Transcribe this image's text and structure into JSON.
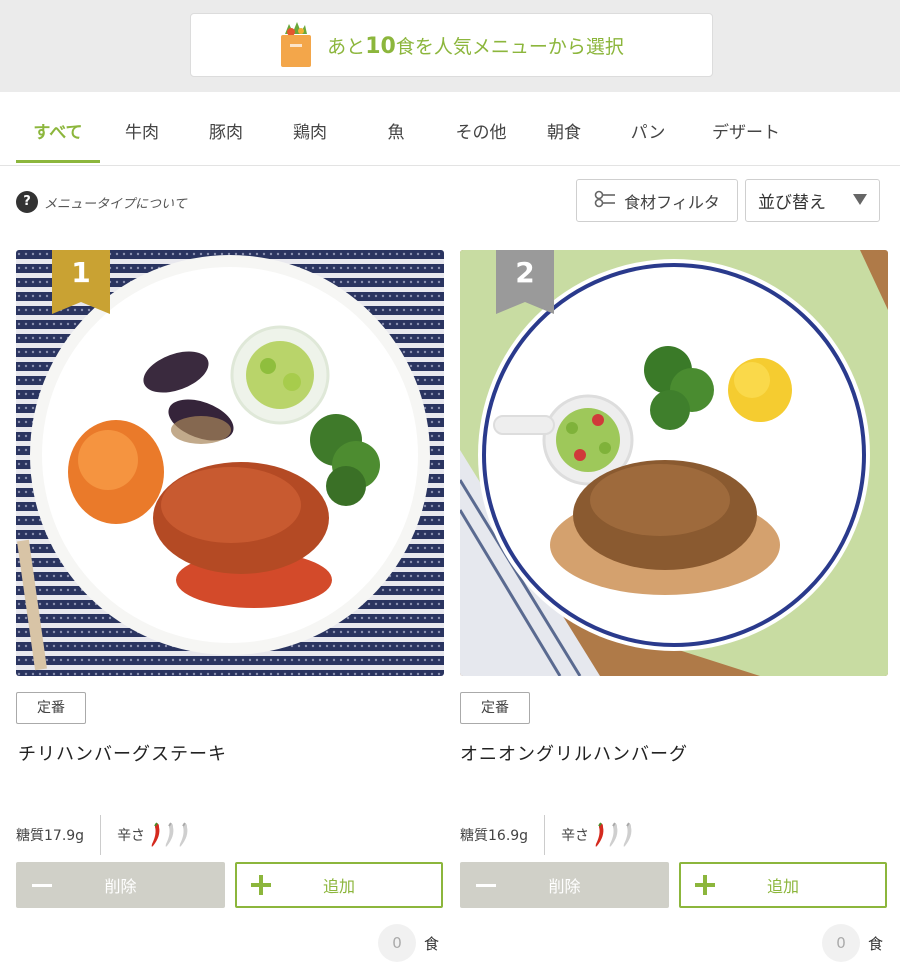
{
  "header": {
    "select_prefix": "あと",
    "select_count": "10",
    "select_suffix": "食を人気メニューから選択",
    "icon": "bag-icon"
  },
  "tabs": [
    {
      "label": "すべて",
      "active": true
    },
    {
      "label": "牛肉"
    },
    {
      "label": "豚肉"
    },
    {
      "label": "鶏肉"
    },
    {
      "label": "魚"
    },
    {
      "label": "その他"
    },
    {
      "label": "朝食"
    },
    {
      "label": "パン"
    },
    {
      "label": "デザート"
    }
  ],
  "toolbar": {
    "help_icon": "?",
    "help_text": "メニュータイプについて",
    "filter_label": "食材フィルタ",
    "sort_label": "並び替え"
  },
  "cards": [
    {
      "rank": "1",
      "tag": "定番",
      "name": "チリハンバーグステーキ",
      "carbs": "糖質17.9g",
      "spicy_label": "辛さ",
      "spicy_level": 1,
      "spicy_max": 3,
      "delete_label": "削除",
      "add_label": "追加",
      "count": "0",
      "unit": "食"
    },
    {
      "rank": "2",
      "tag": "定番",
      "name": "オニオングリルハンバーグ",
      "carbs": "糖質16.9g",
      "spicy_label": "辛さ",
      "spicy_level": 1,
      "spicy_max": 3,
      "delete_label": "削除",
      "add_label": "追加",
      "count": "0",
      "unit": "食"
    }
  ],
  "colors": {
    "accent": "#8cb63c",
    "gold_badge": "#c9a233",
    "silver_badge": "#9a9a9a",
    "delete_bg": "#d0d0c8",
    "chili": "#d42a1e"
  }
}
